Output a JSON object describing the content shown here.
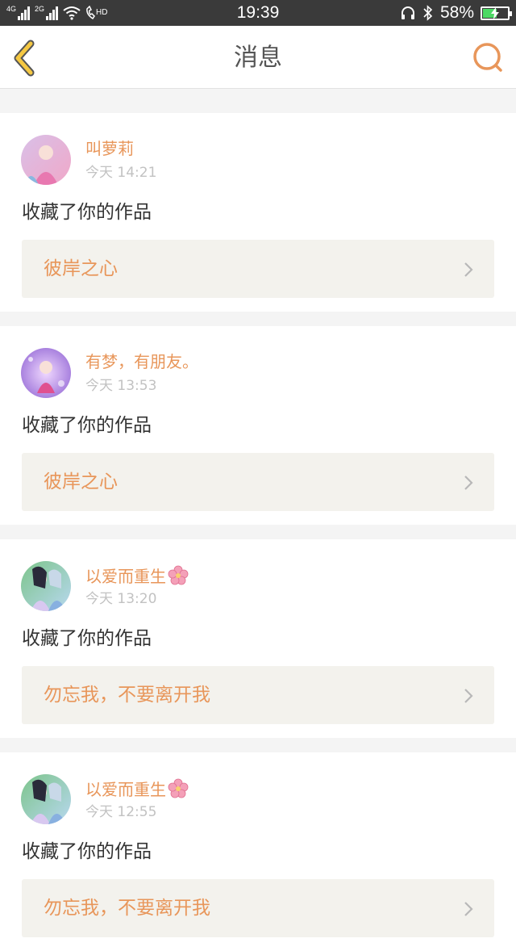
{
  "status_bar": {
    "network_1": "4G",
    "network_2": "2G",
    "hd_label": "HD",
    "time": "19:39",
    "battery_percent": "58%",
    "battery_level": 0.58
  },
  "nav": {
    "title": "消息"
  },
  "messages": [
    {
      "username": "叫萝莉",
      "time": "今天 14:21",
      "action": "收藏了你的作品",
      "work_title": "彼岸之心",
      "avatar_colors": [
        "#d9c0e8",
        "#f0a8c8"
      ]
    },
    {
      "username": "有梦，有朋友。",
      "time": "今天 13:53",
      "action": "收藏了你的作品",
      "work_title": "彼岸之心",
      "avatar_colors": [
        "#c8b5f0",
        "#e070d0"
      ]
    },
    {
      "username": "以爱而重生",
      "time": "今天 13:20",
      "action": "收藏了你的作品",
      "work_title": "勿忘我，不要离开我",
      "avatar_colors": [
        "#9fcf9a",
        "#a8c8e8"
      ]
    },
    {
      "username": "以爱而重生",
      "time": "今天 12:55",
      "action": "收藏了你的作品",
      "work_title": "勿忘我，不要离开我",
      "avatar_colors": [
        "#9fcf9a",
        "#a8c8e8"
      ]
    }
  ],
  "colors": {
    "accent": "#e8965a",
    "back_icon": "#f5c842",
    "status_bar_bg": "#3a3a3a",
    "page_bg": "#f4f4f4",
    "link_bg": "#f3f2ed"
  }
}
